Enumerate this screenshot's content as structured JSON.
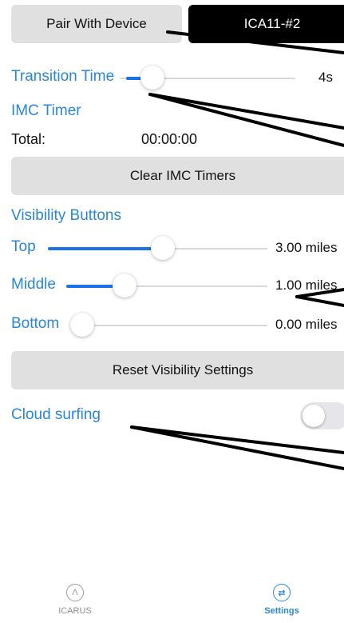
{
  "header": {
    "pair_button": "Pair With Device",
    "device_button": "ICA11-#2"
  },
  "transition": {
    "label": "Transition Time",
    "value_text": "4s",
    "level": 0.13
  },
  "imc_timer": {
    "heading": "IMC Timer",
    "total_label": "Total:",
    "total_value": "00:00:00",
    "clear_button": "Clear IMC Timers"
  },
  "visibility": {
    "heading": "Visibility Buttons",
    "sliders": [
      {
        "label": "Top",
        "value_text": "3.00 miles",
        "level": 0.52
      },
      {
        "label": "Middle",
        "value_text": "1.00 miles",
        "level": 0.27
      },
      {
        "label": "Bottom",
        "value_text": "0.00 miles",
        "level": 0.0
      }
    ],
    "reset_button": "Reset Visibility Settings"
  },
  "cloud_surfing": {
    "label": "Cloud surfing",
    "enabled": false
  },
  "tabbar": {
    "items": [
      {
        "label": "ICARUS",
        "icon": "chevron-up-circle-icon",
        "active": false
      },
      {
        "label": "Settings",
        "icon": "swap-arrows-circle-icon",
        "active": true
      }
    ]
  },
  "colors": {
    "accent": "#2a86d8",
    "slider_fill": "#1a73e8",
    "button_gray": "#e0e0e0",
    "button_black": "#000000"
  }
}
